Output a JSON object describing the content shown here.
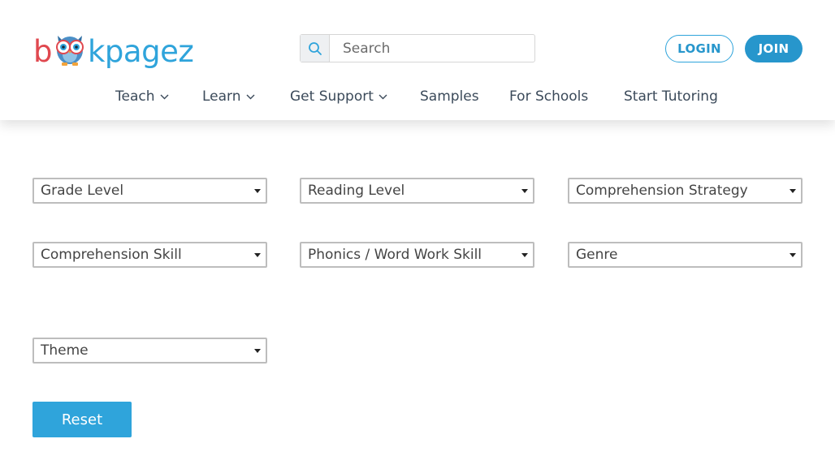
{
  "brand": {
    "logo_part_b": "b",
    "logo_part_rest": "kpagez",
    "logo_colors": {
      "b": "#e0484f",
      "rest": "#2fa4db"
    }
  },
  "search": {
    "placeholder": "Search",
    "value": "",
    "icon": "search-icon"
  },
  "auth": {
    "login_label": "LOGIN",
    "join_label": "JOIN"
  },
  "nav": {
    "items": [
      {
        "label": "Teach",
        "has_dropdown": true
      },
      {
        "label": "Learn",
        "has_dropdown": true
      },
      {
        "label": "Get Support",
        "has_dropdown": true
      },
      {
        "label": "Samples",
        "has_dropdown": false
      },
      {
        "label": "For Schools",
        "has_dropdown": false
      },
      {
        "label": "Start Tutoring",
        "has_dropdown": false
      }
    ]
  },
  "filters": [
    {
      "label": "Grade Level"
    },
    {
      "label": "Reading Level"
    },
    {
      "label": "Comprehension Strategy"
    },
    {
      "label": "Comprehension Skill"
    },
    {
      "label": "Phonics / Word Work Skill"
    },
    {
      "label": "Genre"
    },
    {
      "label": "Theme"
    }
  ],
  "reset_label": "Reset",
  "colors": {
    "accent": "#2fa4db",
    "accent_dark": "#2796cc",
    "nav_text": "#3b4a5a"
  }
}
